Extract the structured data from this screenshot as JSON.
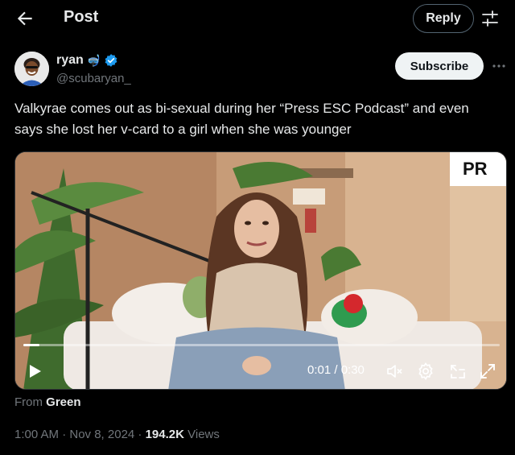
{
  "header": {
    "title": "Post",
    "reply_label": "Reply",
    "back_icon": "arrow-left-icon",
    "settings_icon": "sliders-icon"
  },
  "author": {
    "name": "ryan",
    "emoji": "🤿",
    "handle": "@scubaryan_",
    "verified_color": "#1d9bf0",
    "subscribe_label": "Subscribe",
    "more_icon": "ellipsis-icon"
  },
  "tweet": {
    "text": "Valkyrae comes out as bi-sexual during her “Press ESC Podcast” and even says she lost her v-card to a girl when she was younger"
  },
  "video": {
    "time": "0:01 / 0:30",
    "progress": 0.033,
    "controls": [
      "play-icon",
      "mute-icon",
      "gear-icon",
      "pip-icon",
      "fullscreen-icon"
    ],
    "sign_text": "PR"
  },
  "footer": {
    "from_label": "From",
    "from_source": "Green",
    "timestamp": "1:00 AM · Nov 8, 2024 · ",
    "views_count": "194.2K",
    "views_label": " Views"
  }
}
